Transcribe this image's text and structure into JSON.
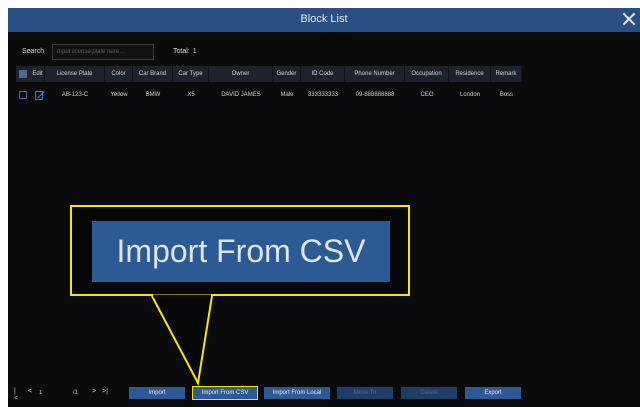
{
  "window": {
    "title": "Block List"
  },
  "search": {
    "label": "Search",
    "placeholder": "Input license plate here ...",
    "value": ""
  },
  "total": {
    "label": "Total:",
    "value": "1"
  },
  "table": {
    "columns": [
      "Edit",
      "License Plate",
      "Color",
      "Car Brand",
      "Car Type",
      "Owner",
      "Gender",
      "ID Code",
      "Phone Number",
      "Occupation",
      "Residence",
      "Remark"
    ],
    "rows": [
      {
        "license_plate": "AB-123-C",
        "color": "Yellow",
        "car_brand": "BMW",
        "car_type": "X5",
        "owner": "DAVID JAMES",
        "gender": "Male",
        "id_code": "333333333",
        "phone_number": "09-888888888",
        "occupation": "CEO",
        "residence": "London",
        "remark": "Boss"
      }
    ]
  },
  "pager": {
    "first": "|<",
    "prev": "<",
    "page_input": "1",
    "page_total": "/1",
    "next": ">",
    "last": ">|"
  },
  "buttons": {
    "import": "Import",
    "import_csv": "Import From CSV",
    "import_local": "Import From Local",
    "move_to": "Move To",
    "delete": "Delete",
    "export": "Export"
  },
  "callout": {
    "label": "Import From CSV"
  },
  "colors": {
    "titlebar": "#2a4f82",
    "button": "#2c5a95",
    "highlight": "#f3ea00",
    "background": "#0b0b0d"
  },
  "icons": {
    "close": "close-icon",
    "edit": "edit-icon"
  }
}
